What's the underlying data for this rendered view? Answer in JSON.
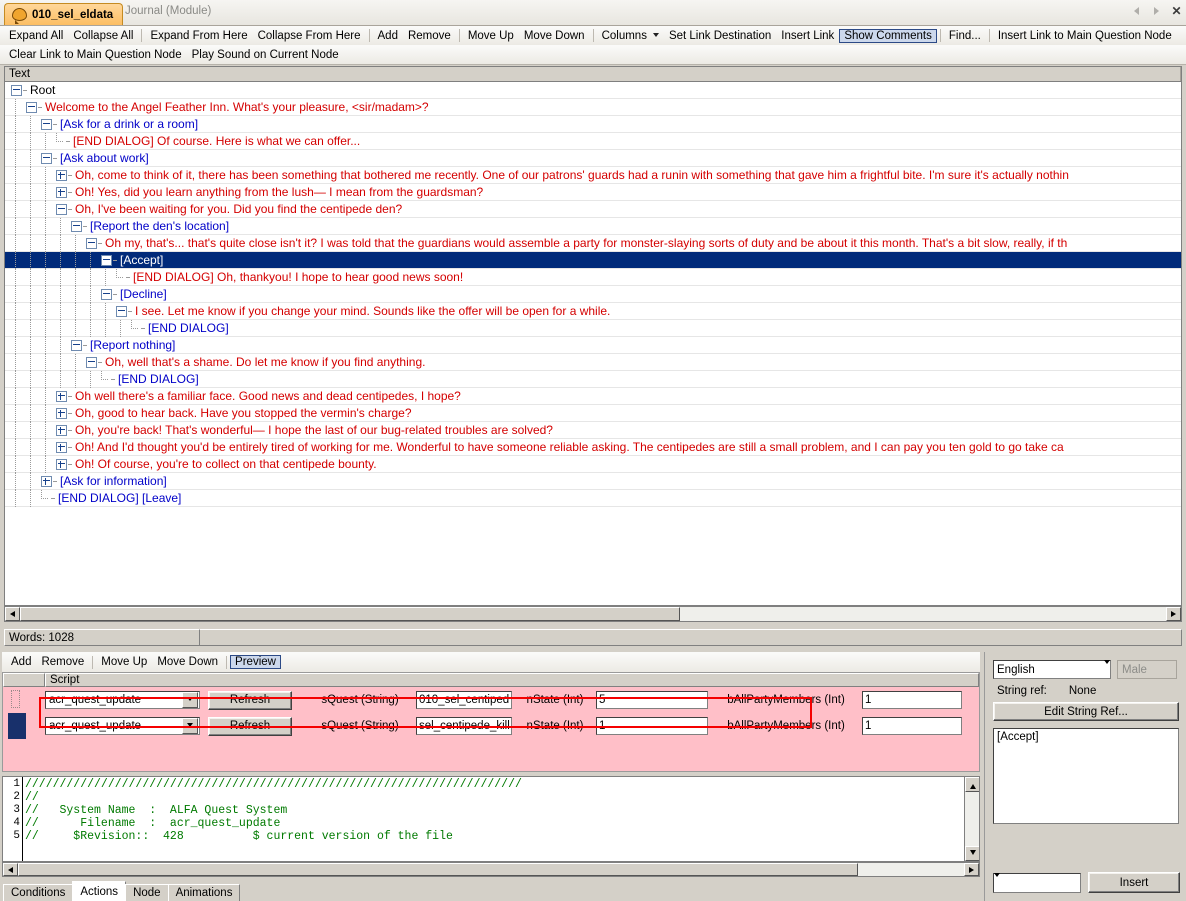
{
  "window": {
    "tab_label": "010_sel_eldata",
    "module_label": "Journal (Module)",
    "icon": "speech-bubble-icon",
    "nav_back": "◁",
    "nav_forward": "▷",
    "close": "✕"
  },
  "toolbar_row1": [
    {
      "label": "Expand All",
      "type": "cmd"
    },
    {
      "label": "Collapse All",
      "type": "cmd"
    },
    {
      "label": "",
      "type": "sep"
    },
    {
      "label": "Expand From Here",
      "type": "cmd"
    },
    {
      "label": "Collapse From Here",
      "type": "cmd"
    },
    {
      "label": "",
      "type": "sep"
    },
    {
      "label": "Add",
      "type": "cmd"
    },
    {
      "label": "Remove",
      "type": "cmd"
    },
    {
      "label": "",
      "type": "sep"
    },
    {
      "label": "Move Up",
      "type": "cmd"
    },
    {
      "label": "Move Down",
      "type": "cmd"
    },
    {
      "label": "",
      "type": "sep"
    },
    {
      "label": "Columns",
      "type": "caret"
    },
    {
      "label": "Set Link Destination",
      "type": "cmd"
    },
    {
      "label": "Insert Link",
      "type": "cmd"
    },
    {
      "label": "Show Comments",
      "type": "boxed"
    },
    {
      "label": "",
      "type": "sep"
    },
    {
      "label": "Find...",
      "type": "cmd"
    },
    {
      "label": "",
      "type": "sep"
    },
    {
      "label": "Insert Link to Main Question Node",
      "type": "cmd"
    }
  ],
  "toolbar_row2": [
    {
      "label": "Clear Link to Main Question Node",
      "type": "cmd"
    },
    {
      "label": "Play Sound on Current Node",
      "type": "cmd"
    }
  ],
  "tree": {
    "column_header": "Text",
    "rows": [
      {
        "depth": 0,
        "state": "minus",
        "speaker": "root",
        "text": "Root"
      },
      {
        "depth": 1,
        "state": "minus",
        "speaker": "npc",
        "text": "Welcome to the Angel Feather Inn. What's your pleasure, <sir/madam>?"
      },
      {
        "depth": 2,
        "state": "minus",
        "speaker": "pc",
        "text": "[Ask for a drink or a room]"
      },
      {
        "depth": 3,
        "state": "leaf",
        "speaker": "npc",
        "text": "[END DIALOG] Of course. Here is what we can offer..."
      },
      {
        "depth": 2,
        "state": "minus",
        "speaker": "pc",
        "text": "[Ask about work]"
      },
      {
        "depth": 3,
        "state": "plus",
        "speaker": "npc",
        "text": "Oh, come to think of it, there has been something that bothered me recently. One of our patrons' guards had a runin with something that gave him a frightful bite. I'm sure it's actually nothin"
      },
      {
        "depth": 3,
        "state": "plus",
        "speaker": "npc",
        "text": "Oh! Yes, did you learn anything from the lush— I mean from the guardsman?"
      },
      {
        "depth": 3,
        "state": "minus",
        "speaker": "npc",
        "text": "Oh, I've been waiting for you. Did you find the centipede den?"
      },
      {
        "depth": 4,
        "state": "minus",
        "speaker": "pc",
        "text": "[Report the den's location]"
      },
      {
        "depth": 5,
        "state": "minus",
        "speaker": "npc",
        "text": "Oh my, that's... that's quite close isn't it? I was told that the guardians would assemble a party for monster-slaying sorts of duty and be about it this month. That's a bit slow, really, if th"
      },
      {
        "depth": 6,
        "state": "minus",
        "speaker": "pc",
        "text": "[Accept]",
        "selected": true
      },
      {
        "depth": 7,
        "state": "leaf",
        "speaker": "npc",
        "text": "[END DIALOG] Oh, thankyou! I hope to hear good news soon!"
      },
      {
        "depth": 6,
        "state": "minus",
        "speaker": "pc",
        "text": "[Decline]"
      },
      {
        "depth": 7,
        "state": "minus",
        "speaker": "npc",
        "text": "I see. Let me know if you change your mind. Sounds like the offer will be open for a while."
      },
      {
        "depth": 8,
        "state": "leaf",
        "speaker": "pc",
        "text": "[END DIALOG]"
      },
      {
        "depth": 4,
        "state": "minus",
        "speaker": "pc",
        "text": "[Report nothing]"
      },
      {
        "depth": 5,
        "state": "minus",
        "speaker": "npc",
        "text": "Oh, well that's a shame. Do let me know if you find anything."
      },
      {
        "depth": 6,
        "state": "leaf",
        "speaker": "pc",
        "text": "[END DIALOG]"
      },
      {
        "depth": 3,
        "state": "plus",
        "speaker": "npc",
        "text": "Oh well there's a familiar face. Good news and dead centipedes, I hope?"
      },
      {
        "depth": 3,
        "state": "plus",
        "speaker": "npc",
        "text": "Oh, good to hear back. Have you stopped the vermin's charge?"
      },
      {
        "depth": 3,
        "state": "plus",
        "speaker": "npc",
        "text": "Oh, you're back! That's wonderful— I hope the last of our bug-related troubles are solved?"
      },
      {
        "depth": 3,
        "state": "plus",
        "speaker": "npc",
        "text": "Oh! And I'd thought you'd be entirely tired of working for me. Wonderful to have someone reliable asking. The centipedes are still a small problem, and I can pay you ten gold to go take ca"
      },
      {
        "depth": 3,
        "state": "plus",
        "speaker": "npc",
        "text": "Oh! Of course, you're to collect on that centipede bounty."
      },
      {
        "depth": 2,
        "state": "plus",
        "speaker": "pc",
        "text": "[Ask for information]"
      },
      {
        "depth": 2,
        "state": "leaf",
        "speaker": "pc",
        "text": "[END DIALOG] [Leave]"
      }
    ]
  },
  "status": {
    "words_label": "Words: 1028"
  },
  "actions_toolbar": [
    {
      "label": "Add",
      "type": "cmd"
    },
    {
      "label": "Remove",
      "type": "cmd"
    },
    {
      "label": "",
      "type": "sep"
    },
    {
      "label": "Move Up",
      "type": "cmd"
    },
    {
      "label": "Move Down",
      "type": "cmd"
    },
    {
      "label": "",
      "type": "sep"
    },
    {
      "label": "Preview",
      "type": "boxed"
    }
  ],
  "script_grid": {
    "header_script": "Script",
    "refresh_label": "Refresh",
    "rows": [
      {
        "script": "acr_quest_update",
        "p1_label": "sQuest (String)",
        "p1_value": "010_sel_centiped",
        "p2_label": "nState (Int)",
        "p2_value": "5",
        "p3_label": "bAllPartyMembers (Int)",
        "p3_value": "1",
        "selected": false
      },
      {
        "script": "acr_quest_update",
        "p1_label": "sQuest (String)",
        "p1_value": "sel_centipede_kill",
        "p2_label": "nState (Int)",
        "p2_value": "1",
        "p3_label": "bAllPartyMembers (Int)",
        "p3_value": "1",
        "selected": true
      }
    ]
  },
  "code_editor": {
    "line_numbers": [
      "1",
      "2",
      "3",
      "4",
      "5"
    ],
    "lines": [
      "////////////////////////////////////////////////////////////////////////",
      "//",
      "//   System Name  :  ALFA Quest System",
      "//      Filename  :  acr_quest_update",
      "//     $Revision::  428          $ current version of the file"
    ]
  },
  "bottom_tabs": [
    {
      "label": "Conditions",
      "active": false
    },
    {
      "label": "Actions",
      "active": true
    },
    {
      "label": "Node",
      "active": false
    },
    {
      "label": "Animations",
      "active": false
    }
  ],
  "right_panel": {
    "language": "English",
    "gender": "Male",
    "string_ref_label": "String ref:",
    "string_ref_value": "None",
    "edit_string_ref": "Edit String Ref...",
    "text_value": "[Accept]",
    "insert_combo": "",
    "insert_label": "Insert"
  },
  "colors": {
    "npc_text": "#d40000",
    "pc_text": "#0000c8",
    "selection": "#002a7a",
    "panel_pink": "#ffbfc8",
    "annotation_red": "#f50000",
    "chrome": "#d4d0c8"
  }
}
